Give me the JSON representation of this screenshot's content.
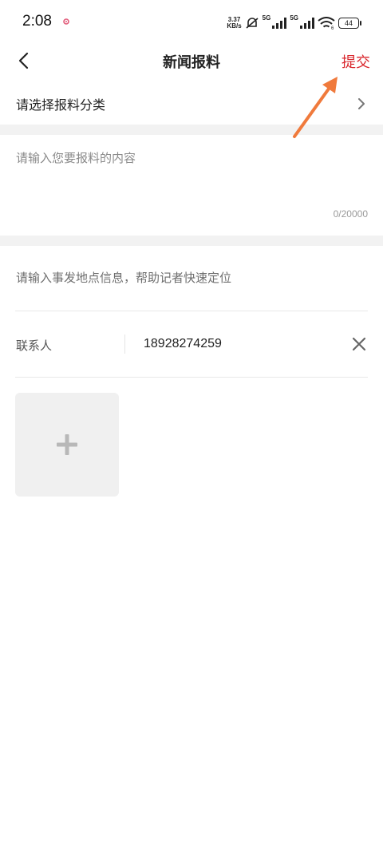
{
  "status_bar": {
    "time": "2:08",
    "net_speed_value": "3.37",
    "net_speed_unit": "KB/s",
    "signal1_label": "5G",
    "signal2_label": "5G",
    "wifi_badge": "6",
    "battery": "44"
  },
  "nav": {
    "title": "新闻报料",
    "submit_label": "提交",
    "accent_color": "#d9262c"
  },
  "form": {
    "category_placeholder": "请选择报料分类",
    "content_placeholder": "请输入您要报料的内容",
    "content_value": "",
    "char_count": "0/20000",
    "location_placeholder": "请输入事发地点信息，帮助记者快速定位",
    "location_value": "",
    "contact_label": "联系人",
    "contact_value": "18928274259"
  },
  "icons": {
    "back": "chevron-left-icon",
    "category_arrow": "chevron-right-icon",
    "clear": "close-icon",
    "upload": "plus-icon"
  }
}
